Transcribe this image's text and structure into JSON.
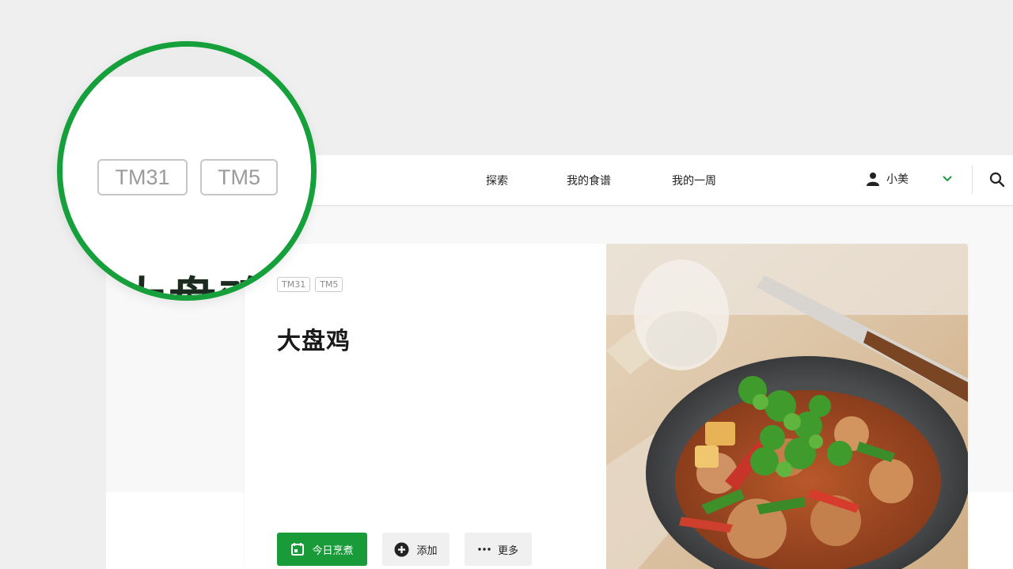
{
  "nav": {
    "items": [
      "探索",
      "我的食谱",
      "我的一周"
    ],
    "user_name": "小美"
  },
  "recipe": {
    "tags": [
      "TM31",
      "TM5"
    ],
    "title": "大盘鸡",
    "buttons": {
      "cook_today": "今日烹煮",
      "add": "添加",
      "more": "更多"
    }
  },
  "magnifier": {
    "tags": [
      "TM31",
      "TM5"
    ],
    "title": "大盘鸡"
  },
  "colors": {
    "accent": "#1a9b3a",
    "magnifier_ring": "#16a03b"
  }
}
